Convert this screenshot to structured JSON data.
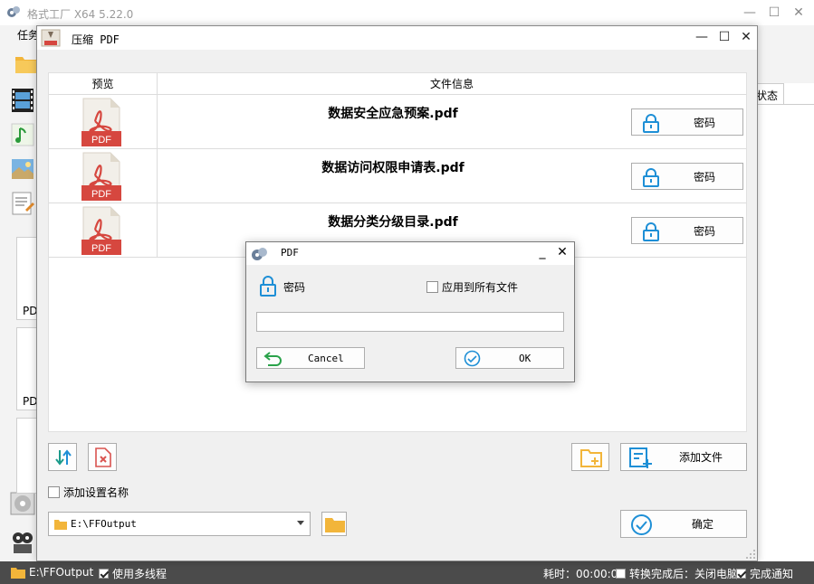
{
  "main_window": {
    "title": "格式工厂 X64 5.22.0",
    "menu_label": "任务",
    "side_card_label": "PD",
    "table_header_status": "状态",
    "controls": {
      "minimize": "—",
      "maximize": "☐",
      "close": "✕"
    }
  },
  "compress_dialog": {
    "title": "压缩 PDF",
    "controls": {
      "minimize": "—",
      "maximize": "☐",
      "close": "✕"
    },
    "table": {
      "col_preview": "预览",
      "col_info": "文件信息",
      "rows": [
        {
          "file_name": "数据安全应急预案.pdf",
          "button_label": "密码",
          "icon_text": "PDF"
        },
        {
          "file_name": "数据访问权限申请表.pdf",
          "button_label": "密码",
          "icon_text": "PDF"
        },
        {
          "file_name": "数据分类分级目录.pdf",
          "button_label": "密码",
          "icon_text": "PDF"
        }
      ]
    },
    "add_file_label": "添加文件",
    "add_name_label": "添加设置名称",
    "output_path": "E:\\FFOutput",
    "confirm_label": "确定"
  },
  "password_dialog": {
    "title": "PDF",
    "minimize": "_",
    "close": "✕",
    "password_label": "密码",
    "apply_all_label": "应用到所有文件",
    "password_value": "",
    "cancel_label": "Cancel",
    "ok_label": "OK"
  },
  "status_bar": {
    "output_path": "E:\\FFOutput",
    "multithread_label": "使用多线程",
    "multithread_checked": true,
    "elapsed_label": "耗时：00:00:05",
    "after_convert_label": "转换完成后：关闭电脑",
    "after_convert_checked": false,
    "notify_label": "完成通知",
    "notify_checked": true
  },
  "colors": {
    "accent_blue": "#1e8fd6",
    "pdf_red": "#d6473f",
    "folder_yellow": "#f2b53a",
    "remove_red": "#d9534f",
    "sort_teal": "#1a9a8a",
    "cancel_green": "#2aa24a"
  }
}
